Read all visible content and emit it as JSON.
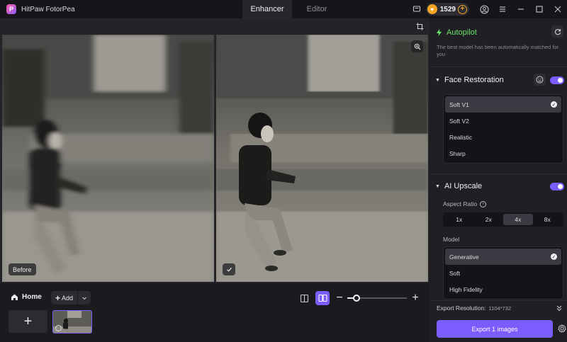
{
  "app": {
    "title": "HitPaw FotorPea",
    "logo_letter": "P"
  },
  "tabs": [
    {
      "label": "Enhancer",
      "active": true
    },
    {
      "label": "Editor",
      "active": false
    }
  ],
  "titlebar": {
    "coins": "1529",
    "coin_plus": "+"
  },
  "canvas": {
    "before_label": "Before"
  },
  "bottom": {
    "home_label": "Home",
    "add_label": "Add",
    "add_plus": "+",
    "add_image_plus": "+",
    "zoom_minus": "−",
    "zoom_plus": "+",
    "zoom_level": 0.15
  },
  "panel": {
    "autopilot": {
      "title": "Autopilot",
      "description": "The best model has been automatically matched for you"
    },
    "face_restoration": {
      "title": "Face Restoration",
      "enabled": true,
      "options": [
        {
          "label": "Soft V1",
          "selected": true
        },
        {
          "label": "Soft V2",
          "selected": false
        },
        {
          "label": "Realistic",
          "selected": false
        },
        {
          "label": "Sharp",
          "selected": false
        }
      ]
    },
    "ai_upscale": {
      "title": "AI Upscale",
      "enabled": true,
      "aspect_ratio_label": "Aspect Ratio",
      "aspect_ratios": [
        {
          "label": "1x",
          "selected": false
        },
        {
          "label": "2x",
          "selected": false
        },
        {
          "label": "4x",
          "selected": true
        },
        {
          "label": "8x",
          "selected": false
        }
      ],
      "model_label": "Model",
      "models": [
        {
          "label": "Generative",
          "selected": true
        },
        {
          "label": "Soft",
          "selected": false
        },
        {
          "label": "High Fidelity",
          "selected": false
        }
      ]
    },
    "export_resolution_label": "Export Resolution:",
    "export_resolution_value": "1104*732",
    "export_button": "Export 1 images"
  },
  "colors": {
    "accent": "#7b5cff",
    "autopilot": "#6ae46a",
    "coin": "#f3a623"
  },
  "icons": [
    "crop-icon",
    "zoom-icon",
    "refresh-icon",
    "face-icon",
    "home-icon",
    "settings-icon",
    "compare-icon"
  ]
}
